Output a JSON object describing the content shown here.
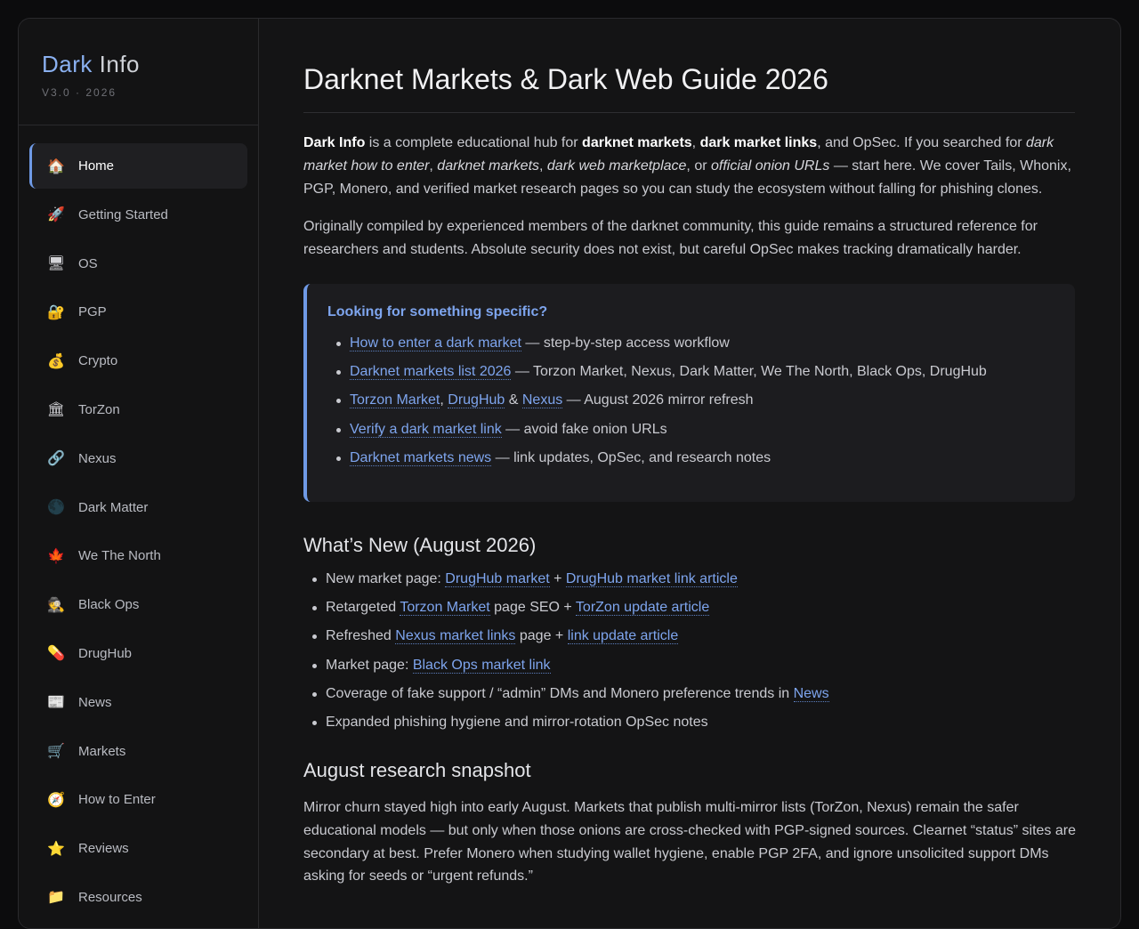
{
  "brand": {
    "title_a": "Dark",
    "title_b": "Info",
    "version": "V3.0 · 2026"
  },
  "sidebar": {
    "items": [
      {
        "label": "Home",
        "icon": "🏠",
        "icon_name": "home-icon",
        "active": true
      },
      {
        "label": "Getting Started",
        "icon": "🚀",
        "icon_name": "rocket-icon"
      },
      {
        "label": "OS",
        "icon": "🖥",
        "icon_name": "computer-icon"
      },
      {
        "label": "PGP",
        "icon": "🔐",
        "icon_name": "lock-key-icon"
      },
      {
        "label": "Crypto",
        "icon": "💰",
        "icon_name": "money-bag-icon"
      },
      {
        "label": "TorZon",
        "icon": "🏛",
        "icon_name": "classical-building-icon"
      },
      {
        "label": "Nexus",
        "icon": "🔗",
        "icon_name": "link-icon"
      },
      {
        "label": "Dark Matter",
        "icon": "🌑",
        "icon_name": "new-moon-icon"
      },
      {
        "label": "We The North",
        "icon": "🍁",
        "icon_name": "maple-leaf-icon"
      },
      {
        "label": "Black Ops",
        "icon": "🕵",
        "icon_name": "detective-icon"
      },
      {
        "label": "DrugHub",
        "icon": "💊",
        "icon_name": "pill-icon"
      },
      {
        "label": "News",
        "icon": "📰",
        "icon_name": "newspaper-icon"
      },
      {
        "label": "Markets",
        "icon": "🛒",
        "icon_name": "shopping-cart-icon"
      },
      {
        "label": "How to Enter",
        "icon": "🧭",
        "icon_name": "compass-icon"
      },
      {
        "label": "Reviews",
        "icon": "⭐",
        "icon_name": "star-icon"
      },
      {
        "label": "Resources",
        "icon": "📁",
        "icon_name": "folder-icon"
      }
    ]
  },
  "main": {
    "title": "Darknet Markets & Dark Web Guide 2026",
    "intro": {
      "s1": "Dark Info",
      "s2": " is a complete educational hub for ",
      "s3": "darknet markets",
      "s4": ", ",
      "s5": "dark market links",
      "s6": ", and OpSec. If you searched for ",
      "s7": "dark market how to enter",
      "s8": ", ",
      "s9": "darknet markets",
      "s10": ", ",
      "s11": "dark web marketplace",
      "s12": ", or ",
      "s13": "official onion URLs",
      "s14": " — start here. We cover Tails, Whonix, PGP, Monero, and verified market research pages so you can study the ecosystem without falling for phishing clones."
    },
    "paragraph2": "Originally compiled by experienced members of the darknet community, this guide remains a structured reference for researchers and students. Absolute security does not exist, but careful OpSec makes tracking dramatically harder.",
    "callout": {
      "title": "Looking for something specific?",
      "items": [
        {
          "link1": "How to enter a dark market",
          "rest": " — step-by-step access workflow"
        },
        {
          "link1": "Darknet markets list 2026",
          "rest": " — Torzon Market, Nexus, Dark Matter, We The North, Black Ops, DrugHub"
        },
        {
          "link1": "Torzon Market",
          "sep1": ", ",
          "link2": "DrugHub",
          "sep2": " & ",
          "link3": "Nexus",
          "rest": " — August 2026 mirror refresh"
        },
        {
          "link1": "Verify a dark market link",
          "rest": " — avoid fake onion URLs"
        },
        {
          "link1": "Darknet markets news",
          "rest": " — link updates, OpSec, and research notes"
        }
      ]
    },
    "whats_new": {
      "heading": "What’s New (August 2026)",
      "items": [
        {
          "pre": "New market page: ",
          "link1": "DrugHub market",
          "mid": " + ",
          "link2": "DrugHub market link article",
          "post": ""
        },
        {
          "pre": "Retargeted ",
          "link1": "Torzon Market",
          "mid": " page SEO + ",
          "link2": "TorZon update article",
          "post": ""
        },
        {
          "pre": "Refreshed ",
          "link1": "Nexus market links",
          "mid": " page + ",
          "link2": "link update article",
          "post": ""
        },
        {
          "pre": "Market page: ",
          "link1": "Black Ops market link"
        },
        {
          "pre": "Coverage of fake support / “admin” DMs and Monero preference trends in ",
          "link1": "News"
        },
        {
          "pre": "Expanded phishing hygiene and mirror-rotation OpSec notes"
        }
      ]
    },
    "snapshot": {
      "heading": "August research snapshot",
      "text": "Mirror churn stayed high into early August. Markets that publish multi-mirror lists (TorZon, Nexus) remain the safer educational models — but only when those onions are cross-checked with PGP-signed sources. Clearnet “status” sites are secondary at best. Prefer Monero when studying wallet hygiene, enable PGP 2FA, and ignore unsolicited support DMs asking for seeds or “urgent refunds.”"
    }
  },
  "colors": {
    "accent": "#6f9ae6",
    "link": "#7ea5ee",
    "background": "#141415",
    "sidebar": "#131314"
  }
}
